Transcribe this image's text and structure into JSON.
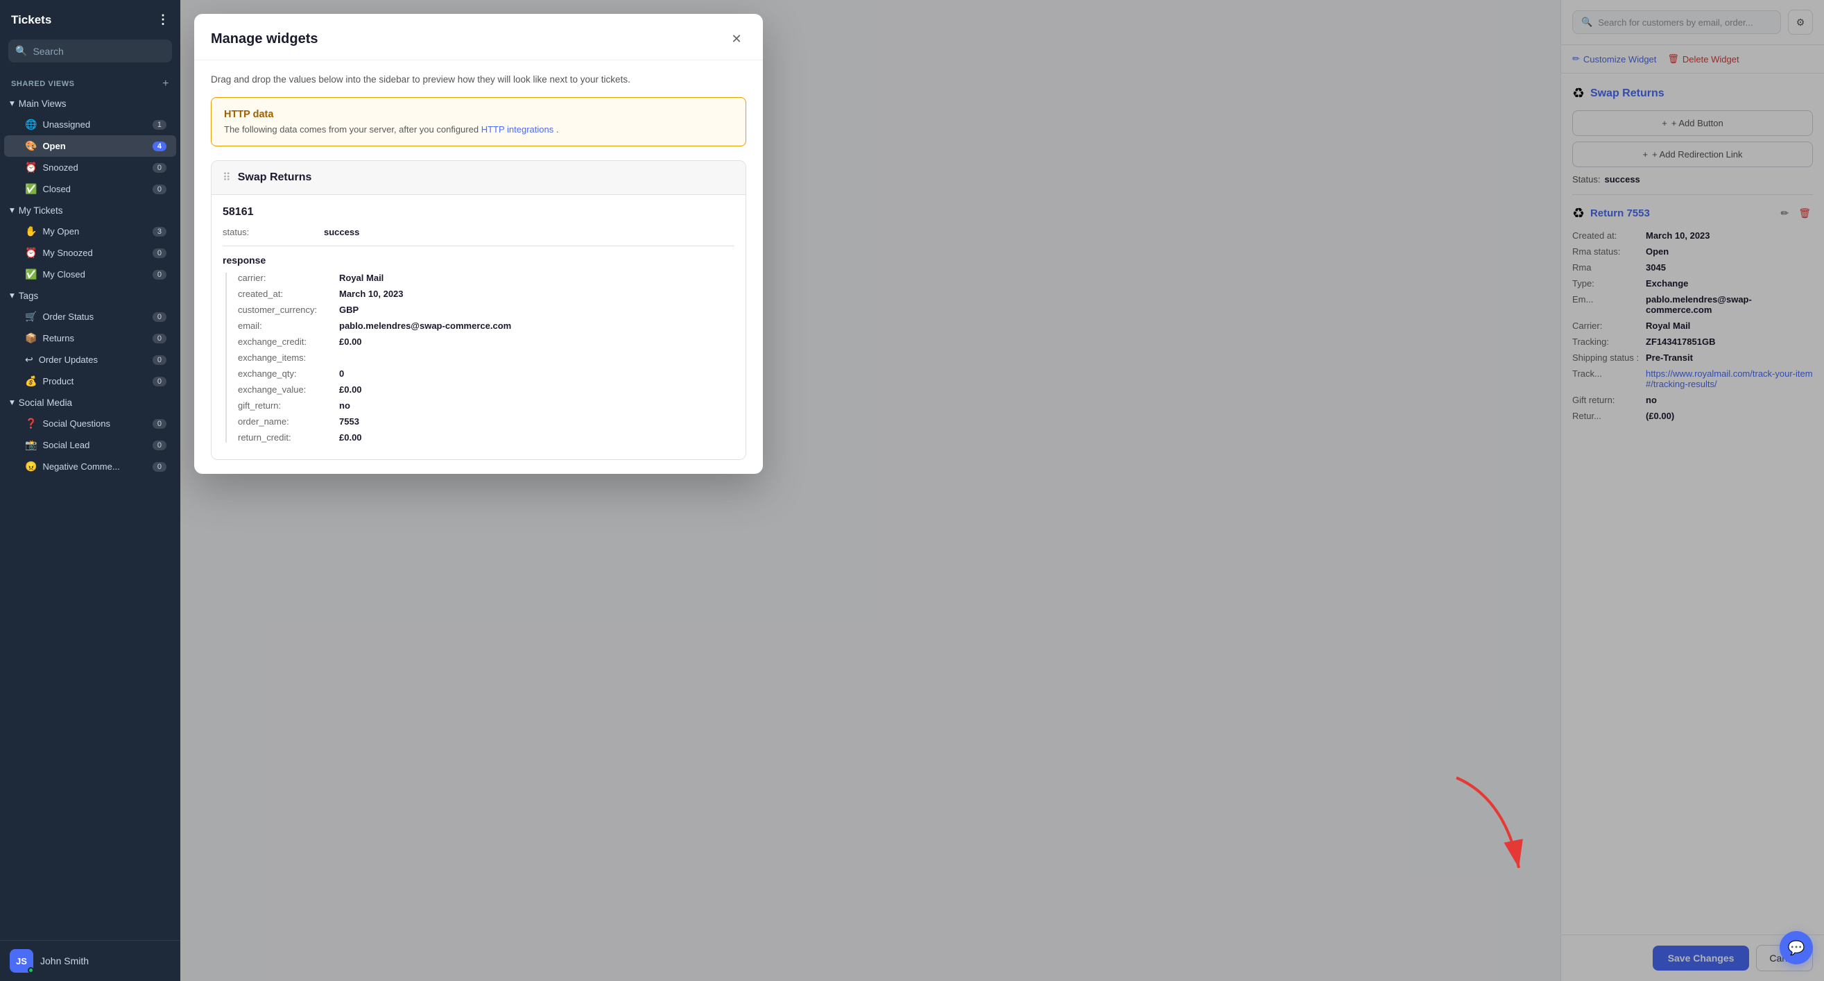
{
  "app": {
    "title": "Tickets",
    "more_icon": "⋮"
  },
  "sidebar": {
    "search_placeholder": "Search",
    "shared_views_label": "SHARED VIEWS",
    "groups": [
      {
        "id": "main-views",
        "label": "Main Views",
        "icon": "▾",
        "items": [
          {
            "id": "unassigned",
            "label": "Unassigned",
            "icon": "🌐",
            "badge": "1",
            "active": false
          },
          {
            "id": "open",
            "label": "Open",
            "icon": "🎨",
            "badge": "4",
            "active": true
          },
          {
            "id": "snoozed",
            "label": "Snoozed",
            "icon": "⏰",
            "badge": "0",
            "active": false
          },
          {
            "id": "closed",
            "label": "Closed",
            "icon": "✅",
            "badge": "0",
            "active": false
          }
        ]
      },
      {
        "id": "my-tickets",
        "label": "My Tickets",
        "icon": "▾",
        "items": [
          {
            "id": "my-open",
            "label": "My Open",
            "icon": "✋",
            "badge": "3",
            "active": false
          },
          {
            "id": "my-snoozed",
            "label": "My Snoozed",
            "icon": "⏰",
            "badge": "0",
            "active": false
          },
          {
            "id": "my-closed",
            "label": "My Closed",
            "icon": "✅",
            "badge": "0",
            "active": false
          }
        ]
      },
      {
        "id": "tags",
        "label": "Tags",
        "icon": "▾",
        "items": [
          {
            "id": "order-status",
            "label": "Order Status",
            "icon": "🛒",
            "badge": "0",
            "active": false
          },
          {
            "id": "returns",
            "label": "Returns",
            "icon": "📦",
            "badge": "0",
            "active": false
          },
          {
            "id": "order-updates",
            "label": "Order Updates",
            "icon": "↩",
            "badge": "0",
            "active": false
          },
          {
            "id": "product",
            "label": "Product",
            "icon": "💰",
            "badge": "0",
            "active": false
          }
        ]
      },
      {
        "id": "social-media",
        "label": "Social Media",
        "icon": "▾",
        "items": [
          {
            "id": "social-questions",
            "label": "Social Questions",
            "icon": "❓",
            "badge": "0",
            "active": false
          },
          {
            "id": "social-lead",
            "label": "Social Lead",
            "icon": "📸",
            "badge": "0",
            "active": false
          },
          {
            "id": "negative-comme",
            "label": "Negative Comme...",
            "icon": "😠",
            "badge": "0",
            "active": false
          }
        ]
      }
    ],
    "user": {
      "name": "John Smith",
      "initials": "JS"
    }
  },
  "modal": {
    "title": "Manage widgets",
    "subtitle": "Drag and drop the values below into the sidebar to preview how they will look like next to your tickets.",
    "http_box": {
      "title": "HTTP data",
      "description": "The following data comes from your server, after you configured ",
      "link_text": "HTTP integrations",
      "description_end": "."
    },
    "widget": {
      "title": "Swap Returns",
      "order_id": "58161",
      "status_label": "status:",
      "status_val": "success",
      "response_title": "response",
      "fields": [
        {
          "key": "carrier:",
          "val": "Royal Mail"
        },
        {
          "key": "created_at:",
          "val": "March 10, 2023"
        },
        {
          "key": "customer_currency:",
          "val": "GBP"
        },
        {
          "key": "email:",
          "val": "pablo.melendres@swap-commerce.com"
        },
        {
          "key": "exchange_credit:",
          "val": "£0.00"
        },
        {
          "key": "exchange_items:",
          "val": ""
        },
        {
          "key": "exchange_qty:",
          "val": "0"
        },
        {
          "key": "exchange_value:",
          "val": "£0.00"
        },
        {
          "key": "gift_return:",
          "val": "no"
        },
        {
          "key": "order_name:",
          "val": "7553"
        },
        {
          "key": "return_credit:",
          "val": "£0.00"
        }
      ]
    }
  },
  "right_panel": {
    "search_placeholder": "Search for customers by email, order...",
    "customize_label": "Customize Widget",
    "delete_label": "Delete Widget",
    "widget_title": "Swap Returns",
    "add_button_label": "+ Add Button",
    "add_redirect_label": "+ Add Redirection Link",
    "status_label": "Status:",
    "status_val": "success",
    "return": {
      "title": "Return 7553",
      "fields": [
        {
          "key": "Created at:",
          "val": "March 10, 2023",
          "link": false
        },
        {
          "key": "Rma status:",
          "val": "Open",
          "link": false
        },
        {
          "key": "Rma",
          "val": "3045",
          "link": false
        },
        {
          "key": "Type:",
          "val": "Exchange",
          "link": false
        },
        {
          "key": "Em...",
          "val": "pablo.melendres@swap-commerce.com",
          "link": false
        },
        {
          "key": "Carrier:",
          "val": "Royal Mail",
          "link": false
        },
        {
          "key": "Tracking:",
          "val": "ZF143417851GB",
          "link": false
        },
        {
          "key": "Shipping status :",
          "val": "Pre-Transit",
          "link": false
        },
        {
          "key": "Track...",
          "val": "https://www.royalmail.com/track-your-item#/tracking-results/",
          "link": true
        },
        {
          "key": "Gift return:",
          "val": "no",
          "link": false
        },
        {
          "key": "Retur...",
          "val": "(£0.00)",
          "link": false
        }
      ]
    },
    "save_label": "Save Changes",
    "cancel_label": "Cancel"
  }
}
